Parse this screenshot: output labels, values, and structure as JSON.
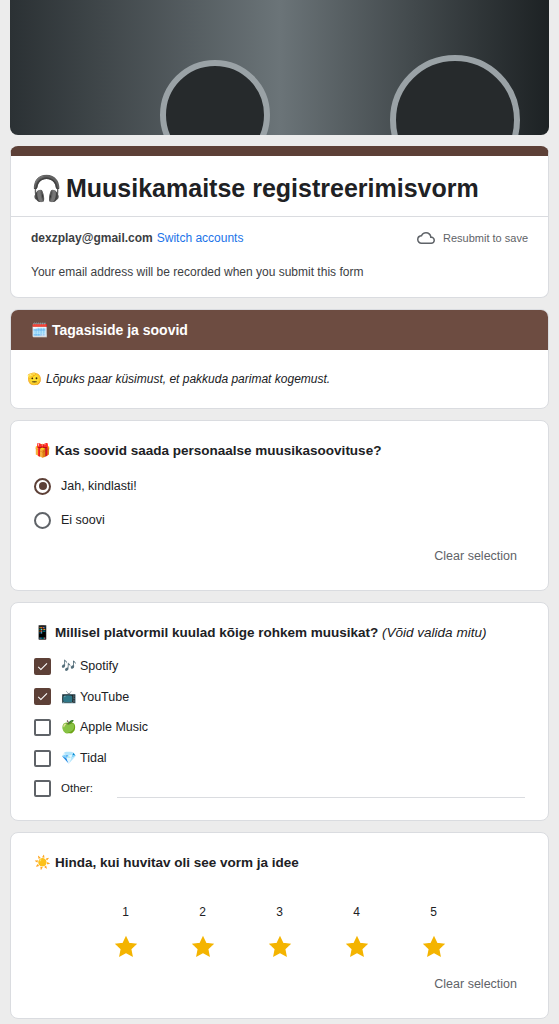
{
  "form": {
    "title_icon": "🎧",
    "title": "Muusikamaitse registreerimisvorm",
    "email": "dexzplay@gmail.com",
    "switch_accounts": "Switch accounts",
    "save_status": "Resubmit to save",
    "notice": "Your email address will be recorded when you submit this form"
  },
  "section": {
    "icon": "🗓️",
    "title": "Tagasiside ja soovid",
    "description_icon": "🫡",
    "description": "Lõpuks paar küsimust, et pakkuda parimat kogemust."
  },
  "questions": [
    {
      "kind": "radio",
      "icon": "🎁",
      "title": "Kas soovid saada personaalse muusikasoovituse?",
      "options": [
        {
          "label": "Jah, kindlasti!",
          "selected": true
        },
        {
          "label": "Ei soovi",
          "selected": false
        }
      ],
      "clear": "Clear selection"
    },
    {
      "kind": "checkbox",
      "icon": "📱",
      "title": "Millisel platvormil kuulad kõige rohkem muusikat?",
      "hint": "(Võid valida mitu)",
      "options": [
        {
          "icon": "🎶",
          "label": "Spotify",
          "checked": true
        },
        {
          "icon": "📺",
          "label": "YouTube",
          "checked": true
        },
        {
          "icon": "🍏",
          "label": "Apple Music",
          "checked": false
        },
        {
          "icon": "💎",
          "label": "Tidal",
          "checked": false
        }
      ],
      "other": {
        "label": "Other:",
        "checked": false
      }
    },
    {
      "kind": "rating",
      "icon": "☀️",
      "title": "Hinda, kui huvitav oli see vorm ja idee",
      "scale": [
        "1",
        "2",
        "3",
        "4",
        "5"
      ],
      "stars": 5,
      "clear": "Clear selection"
    }
  ]
}
